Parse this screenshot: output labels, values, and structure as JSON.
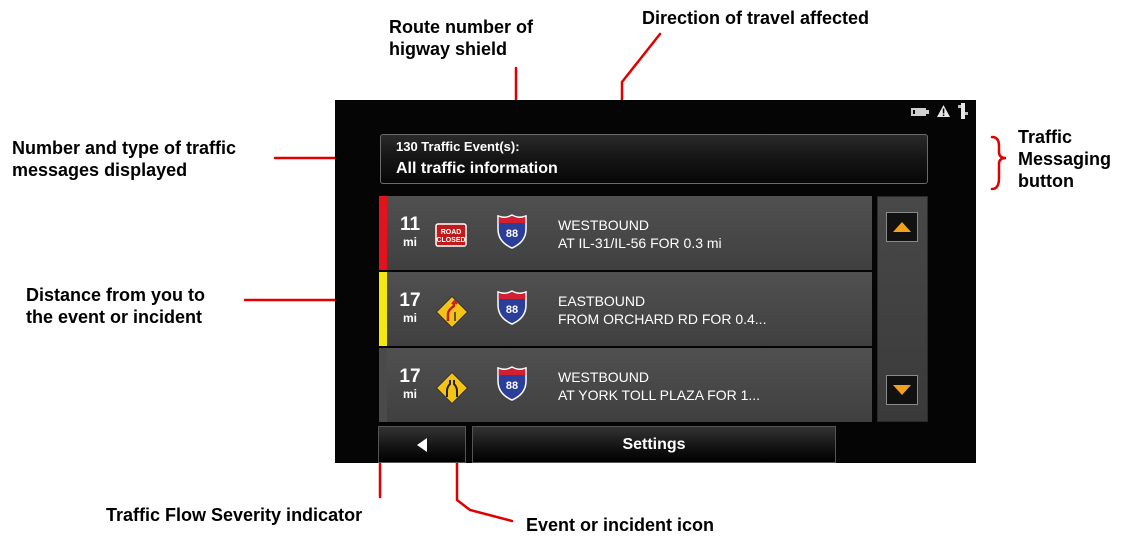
{
  "annotations": {
    "route_number": [
      "Route number of",
      "higway shield"
    ],
    "direction": "Direction of travel affected",
    "message_count": [
      "Number and type of traffic",
      "messages displayed"
    ],
    "messaging_button": [
      "Traffic",
      "Messaging",
      "button"
    ],
    "distance": [
      "Distance from you to",
      "the event or incident"
    ],
    "severity": "Traffic Flow Severity indicator",
    "event_icon": "Event or incident icon"
  },
  "traffic_button": {
    "count_text": "130 Traffic Event(s):",
    "filter_text": "All traffic information"
  },
  "events": [
    {
      "distance": "11",
      "unit": "mi",
      "severity_color": "#e4131b",
      "icon": "road-closed-icon",
      "road_closed_text": [
        "ROAD",
        "CLOSED"
      ],
      "route": "88",
      "direction": "WESTBOUND",
      "detail": "AT IL-31/IL-56 FOR 0.3 mi"
    },
    {
      "distance": "17",
      "unit": "mi",
      "severity_color": "#f3e90c",
      "icon": "lane-shift-icon",
      "route": "88",
      "direction": "EASTBOUND",
      "detail": "FROM ORCHARD RD FOR 0.4..."
    },
    {
      "distance": "17",
      "unit": "mi",
      "severity_color": "#4a4a4a",
      "icon": "road-narrows-icon",
      "route": "88",
      "direction": "WESTBOUND",
      "detail": "AT YORK TOLL PLAZA FOR 1..."
    }
  ],
  "bottom_bar": {
    "settings_label": "Settings"
  },
  "colors": {
    "annotation_line": "#e10000",
    "scroll_arrow": "#f4a11a",
    "sign_yellow": "#f3c316",
    "shield_blue": "#2b3f9a",
    "shield_red": "#d22030"
  }
}
